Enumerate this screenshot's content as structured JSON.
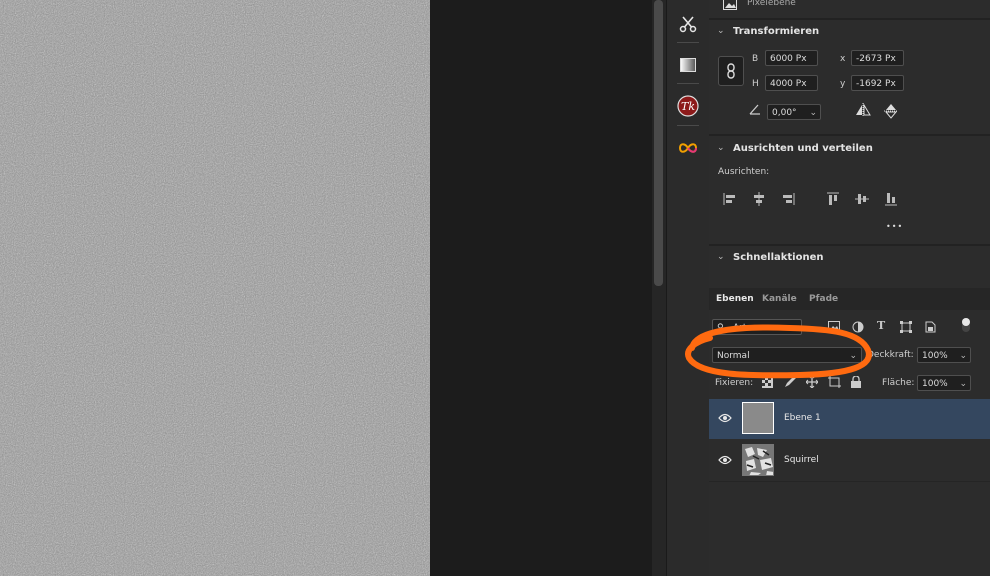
{
  "properties": {
    "layer_type": "Pixelebene",
    "transform": {
      "title": "Transformieren",
      "b_label": "B",
      "b_value": "6000 Px",
      "h_label": "H",
      "h_value": "4000 Px",
      "x_label": "x",
      "x_value": "-2673 Px",
      "y_label": "y",
      "y_value": "-1692 Px",
      "angle_value": "0,00°"
    },
    "align": {
      "title": "Ausrichten und verteilen",
      "label": "Ausrichten:",
      "more": "•••"
    },
    "quick_actions": {
      "title": "Schnellaktionen"
    }
  },
  "layers_panel": {
    "tabs": [
      "Ebenen",
      "Kanäle",
      "Pfade"
    ],
    "filter_value": "Art",
    "blend_mode": "Normal",
    "opacity_label": "Deckkraft:",
    "opacity_value": "100%",
    "lock_label": "Fixieren:",
    "fill_label": "Fläche:",
    "fill_value": "100%",
    "layers": [
      {
        "name": "Ebene 1",
        "selected": true
      },
      {
        "name": "Squirrel",
        "selected": false
      }
    ]
  },
  "colors": {
    "accent_selected": "#34475f",
    "annotation_orange": "#ff6a10",
    "canvas_gray": "#8a8a8a"
  }
}
